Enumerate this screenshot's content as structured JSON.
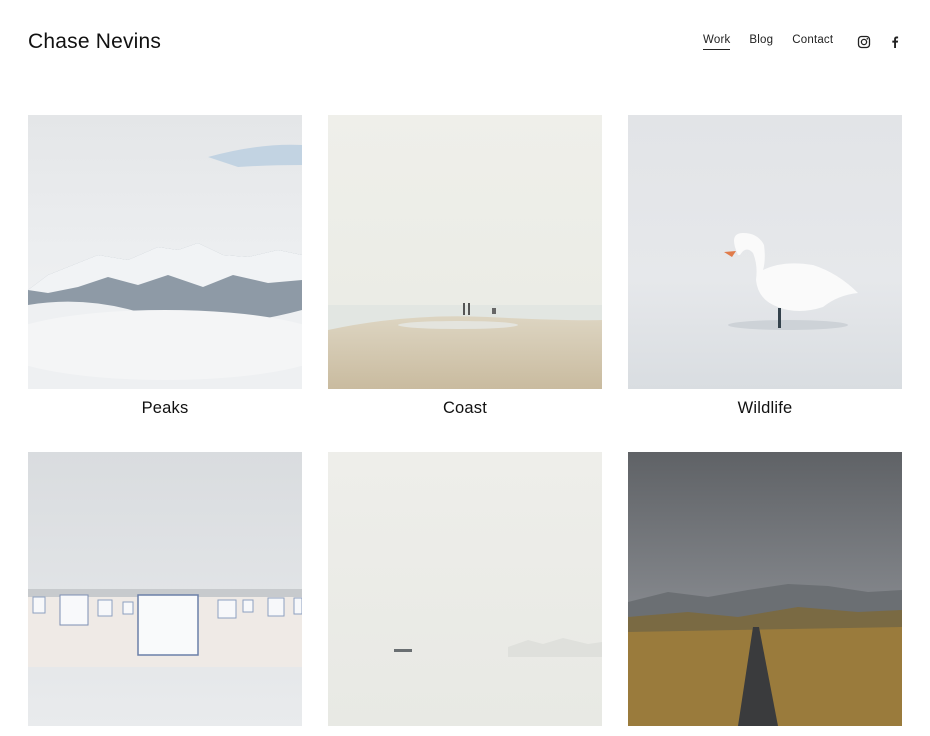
{
  "site": {
    "title": "Chase Nevins"
  },
  "nav": {
    "items": [
      {
        "label": "Work",
        "active": true
      },
      {
        "label": "Blog",
        "active": false
      },
      {
        "label": "Contact",
        "active": false
      }
    ]
  },
  "social": {
    "icons": [
      "instagram-icon",
      "facebook-icon"
    ]
  },
  "gallery": {
    "items": [
      {
        "caption": "Peaks"
      },
      {
        "caption": "Coast"
      },
      {
        "caption": "Wildlife"
      },
      {
        "caption": ""
      },
      {
        "caption": ""
      },
      {
        "caption": ""
      }
    ]
  },
  "colors": {
    "text": "#111111",
    "background": "#ffffff"
  }
}
